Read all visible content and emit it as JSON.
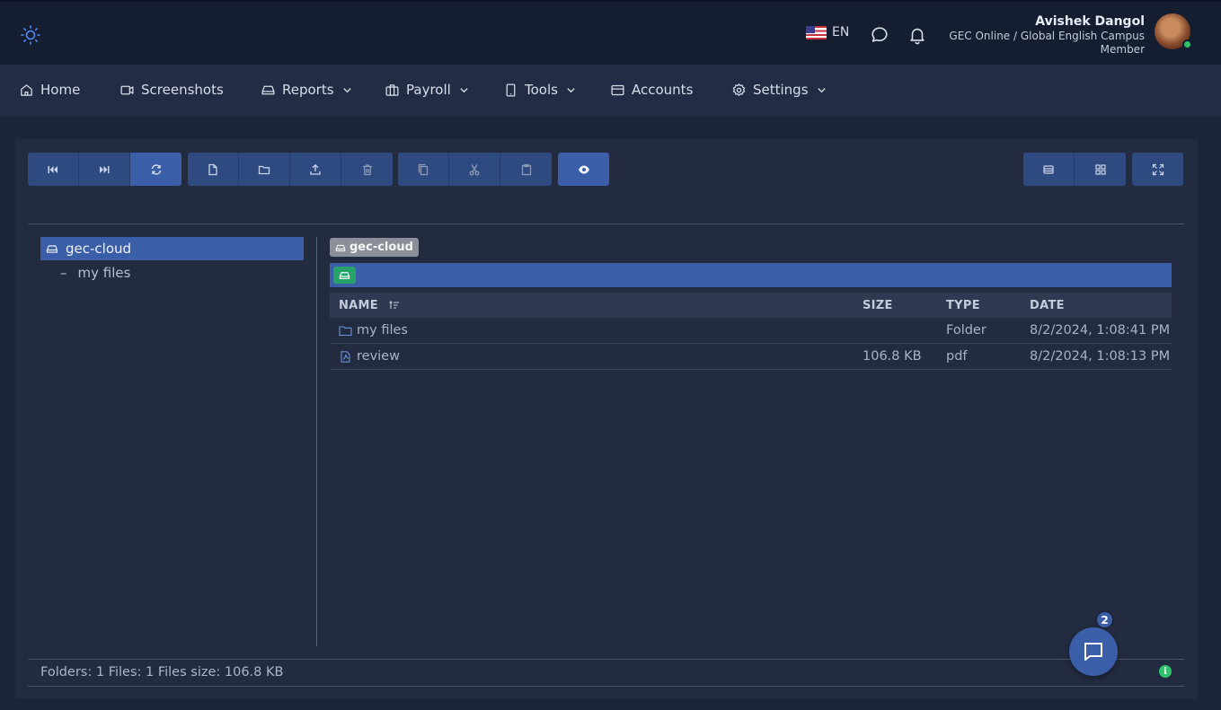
{
  "header": {
    "language": "EN",
    "user_name": "Avishek Dangol",
    "user_org": "GEC Online / Global English Campus",
    "user_role": "Member",
    "icons": [
      "sun-icon",
      "us-flag-icon",
      "chat-icon",
      "bell-icon"
    ],
    "status_color": "#2ec36b"
  },
  "nav": {
    "items": [
      {
        "label": "Home",
        "icon": "home-icon"
      },
      {
        "label": "Screenshots",
        "icon": "video-icon"
      },
      {
        "label": "Reports",
        "icon": "drive-icon",
        "dropdown": true
      },
      {
        "label": "Payroll",
        "icon": "briefcase-icon",
        "dropdown": true
      },
      {
        "label": "Tools",
        "icon": "tablet-icon",
        "dropdown": true
      },
      {
        "label": "Accounts",
        "icon": "credit-card-icon"
      },
      {
        "label": "Settings",
        "icon": "gear-icon",
        "dropdown": true
      }
    ]
  },
  "toolbar": {
    "groups": [
      [
        "skip-back-icon",
        "skip-forward-icon",
        "refresh-icon"
      ],
      [
        "new-file-icon",
        "new-folder-icon",
        "upload-icon",
        "delete-icon"
      ],
      [
        "copy-icon",
        "cut-icon",
        "paste-icon"
      ],
      [
        "preview-eye-icon"
      ],
      [
        "details-view-icon",
        "grid-view-icon"
      ],
      [
        "fullscreen-icon"
      ]
    ],
    "accent_color": "#3a5ea7"
  },
  "tree": {
    "root": "gec-cloud",
    "children": [
      "my files"
    ]
  },
  "breadcrumb": {
    "label": "gec-cloud"
  },
  "grid": {
    "columns": {
      "name": "NAME",
      "size": "SIZE",
      "type": "TYPE",
      "date": "DATE"
    },
    "rows": [
      {
        "name": "my files",
        "size": "",
        "type": "Folder",
        "date": "8/2/2024, 1:08:41 PM",
        "icon": "folder-icon"
      },
      {
        "name": "review",
        "size": "106.8 KB",
        "type": "pdf",
        "date": "8/2/2024, 1:08:13 PM",
        "icon": "pdf-file-icon"
      }
    ]
  },
  "status": {
    "text": "Folders: 1 Files: 1 Files size: 106.8 KB",
    "info_icon": "i"
  },
  "chat": {
    "badge_count": "2"
  }
}
